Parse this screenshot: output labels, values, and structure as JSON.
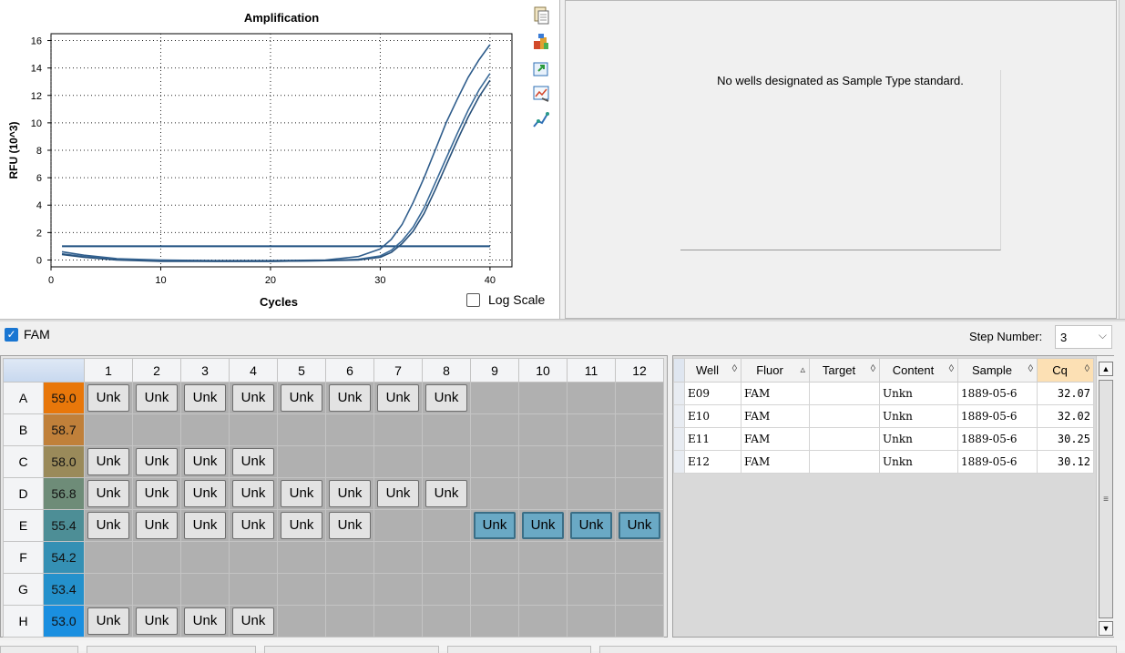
{
  "chart_data": {
    "type": "line",
    "title": "Amplification",
    "xlabel": "Cycles",
    "ylabel": "RFU (10^3)",
    "xlim": [
      0,
      42
    ],
    "ylim": [
      -0.5,
      16.5
    ],
    "xticks": [
      0,
      10,
      20,
      30,
      40
    ],
    "yticks": [
      0,
      2,
      4,
      6,
      8,
      10,
      12,
      14,
      16
    ],
    "grid": "dotted",
    "threshold": 1.0,
    "series": [
      {
        "x": [
          1,
          3,
          6,
          10,
          15,
          20,
          25,
          28,
          30,
          31,
          32,
          33,
          34,
          35,
          36,
          37,
          38,
          39,
          40
        ],
        "y": [
          0.6,
          0.35,
          0.1,
          0.0,
          -0.05,
          -0.05,
          0.0,
          0.25,
          0.8,
          1.5,
          2.6,
          4.2,
          6.0,
          8.0,
          10.0,
          11.7,
          13.3,
          14.6,
          15.7
        ]
      },
      {
        "x": [
          1,
          3,
          6,
          10,
          15,
          20,
          25,
          28,
          30,
          31,
          32,
          33,
          34,
          35,
          36,
          37,
          38,
          39,
          40
        ],
        "y": [
          0.45,
          0.25,
          0.05,
          -0.05,
          -0.1,
          -0.1,
          -0.05,
          0.05,
          0.3,
          0.7,
          1.4,
          2.4,
          3.8,
          5.6,
          7.4,
          9.2,
          10.9,
          12.4,
          13.6
        ]
      },
      {
        "x": [
          1,
          3,
          6,
          10,
          15,
          20,
          25,
          28,
          30,
          31,
          32,
          33,
          34,
          35,
          36,
          37,
          38,
          39,
          40
        ],
        "y": [
          0.4,
          0.2,
          0.0,
          -0.1,
          -0.1,
          -0.1,
          -0.05,
          0.0,
          0.2,
          0.55,
          1.2,
          2.1,
          3.4,
          5.1,
          6.9,
          8.7,
          10.4,
          11.9,
          13.1
        ]
      }
    ]
  },
  "panel": {
    "log_scale_label": "Log Scale",
    "no_standard_msg": "No wells designated as Sample Type standard."
  },
  "toolbar_icons": [
    "copy-icon",
    "color-palette-icon",
    "export-icon",
    "chart-settings-icon",
    "trace-style-icon"
  ],
  "fluor": {
    "label": "FAM",
    "checked": true
  },
  "step": {
    "label": "Step Number:",
    "value": "3"
  },
  "plate": {
    "columns": [
      "1",
      "2",
      "3",
      "4",
      "5",
      "6",
      "7",
      "8",
      "9",
      "10",
      "11",
      "12"
    ],
    "rows": [
      {
        "label": "A",
        "temp": "59.0",
        "temp_color": "#e8770a",
        "wells": [
          "Unk",
          "Unk",
          "Unk",
          "Unk",
          "Unk",
          "Unk",
          "Unk",
          "Unk",
          "",
          "",
          "",
          ""
        ]
      },
      {
        "label": "B",
        "temp": "58.7",
        "temp_color": "#c0803a",
        "wells": [
          "",
          "",
          "",
          "",
          "",
          "",
          "",
          "",
          "",
          "",
          "",
          ""
        ]
      },
      {
        "label": "C",
        "temp": "58.0",
        "temp_color": "#9a8a5a",
        "wells": [
          "Unk",
          "Unk",
          "Unk",
          "Unk",
          "",
          "",
          "",
          "",
          "",
          "",
          "",
          ""
        ]
      },
      {
        "label": "D",
        "temp": "56.8",
        "temp_color": "#6e8c78",
        "wells": [
          "Unk",
          "Unk",
          "Unk",
          "Unk",
          "Unk",
          "Unk",
          "Unk",
          "Unk",
          "",
          "",
          "",
          ""
        ]
      },
      {
        "label": "E",
        "temp": "55.4",
        "temp_color": "#4d8e96",
        "wells": [
          "Unk",
          "Unk",
          "Unk",
          "Unk",
          "Unk",
          "Unk",
          "",
          "",
          "Unk",
          "Unk",
          "Unk",
          "Unk"
        ]
      },
      {
        "label": "F",
        "temp": "54.2",
        "temp_color": "#3590b4",
        "wells": [
          "",
          "",
          "",
          "",
          "",
          "",
          "",
          "",
          "",
          "",
          "",
          ""
        ]
      },
      {
        "label": "G",
        "temp": "53.4",
        "temp_color": "#2491cc",
        "wells": [
          "",
          "",
          "",
          "",
          "",
          "",
          "",
          "",
          "",
          "",
          "",
          ""
        ]
      },
      {
        "label": "H",
        "temp": "53.0",
        "temp_color": "#1a8fe0",
        "wells": [
          "Unk",
          "Unk",
          "Unk",
          "Unk",
          "",
          "",
          "",
          "",
          "",
          "",
          "",
          ""
        ]
      }
    ],
    "selected": [
      "E9",
      "E10",
      "E11",
      "E12"
    ]
  },
  "results": {
    "columns": [
      {
        "label": "Well",
        "sort": "◊"
      },
      {
        "label": "Fluor",
        "sort": "▵"
      },
      {
        "label": "Target",
        "sort": "◊"
      },
      {
        "label": "Content",
        "sort": "◊"
      },
      {
        "label": "Sample",
        "sort": "◊"
      },
      {
        "label": "Cq",
        "sort": "◊"
      }
    ],
    "rows": [
      [
        "E09",
        "FAM",
        "",
        "Unkn",
        "1889-05-6",
        "32.07"
      ],
      [
        "E10",
        "FAM",
        "",
        "Unkn",
        "1889-05-6",
        "32.02"
      ],
      [
        "E11",
        "FAM",
        "",
        "Unkn",
        "1889-05-6",
        "30.25"
      ],
      [
        "E12",
        "FAM",
        "",
        "Unkn",
        "1889-05-6",
        "30.12"
      ]
    ]
  }
}
